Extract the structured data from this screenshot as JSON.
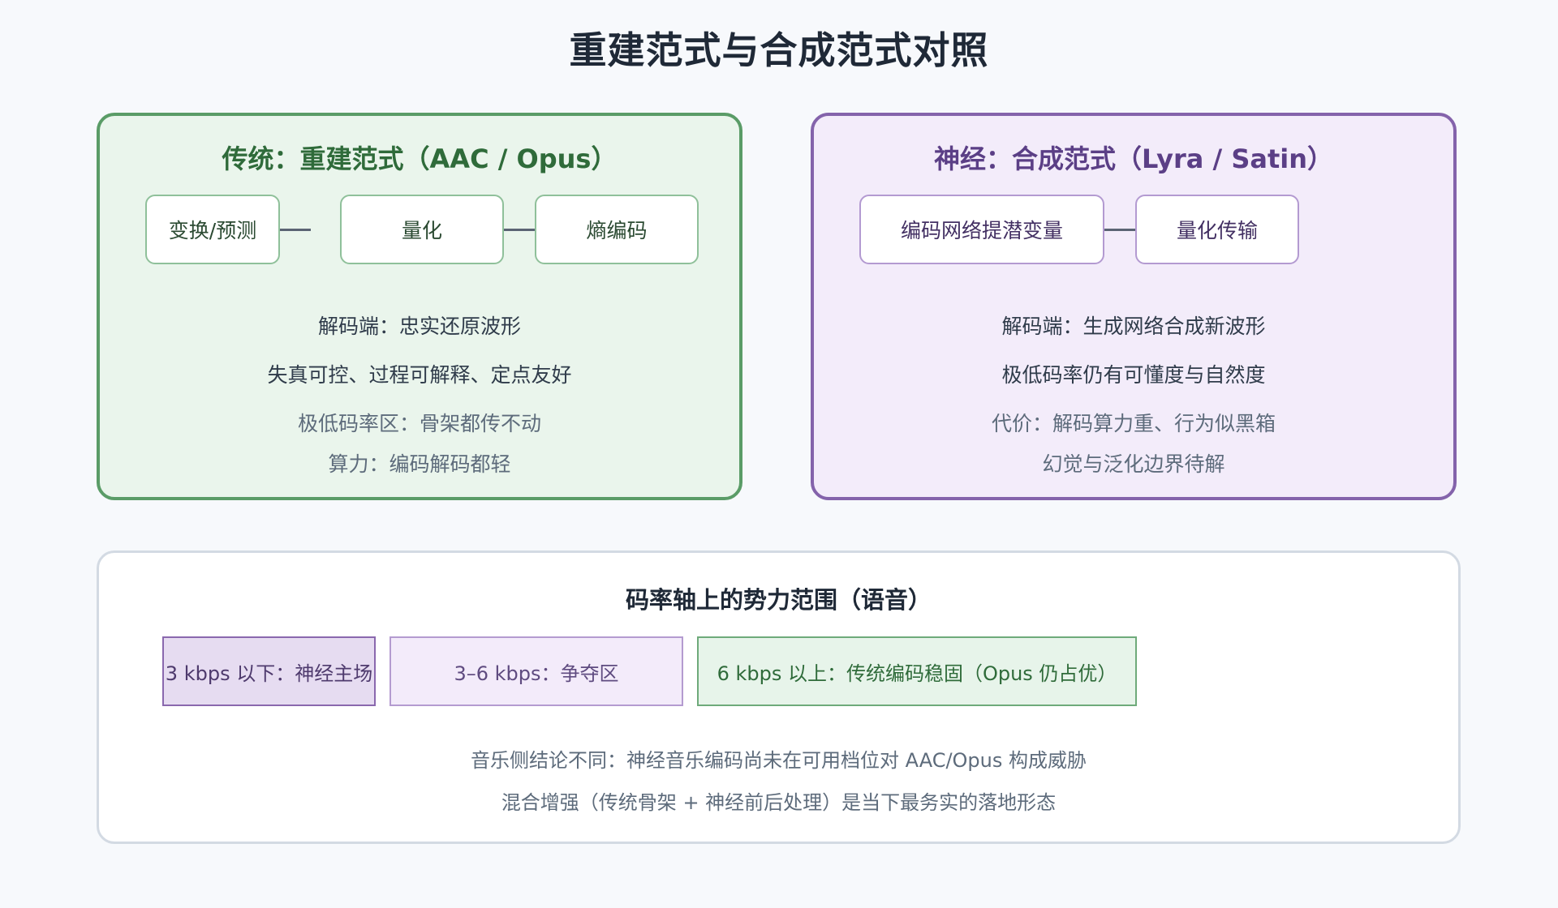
{
  "title": "重建范式与合成范式对照",
  "traditional": {
    "title": "传统：重建范式（AAC / Opus）",
    "steps": [
      "变换/预测",
      "量化",
      "熵编码"
    ],
    "notes": [
      "解码端：忠实还原波形",
      "失真可控、过程可解释、定点友好",
      "极低码率区：骨架都传不动",
      "算力：编码解码都轻"
    ]
  },
  "neural": {
    "title": "神经：合成范式（Lyra / Satin）",
    "steps": [
      "编码网络提潜变量",
      "量化传输"
    ],
    "notes": [
      "解码端：生成网络合成新波形",
      "极低码率仍有可懂度与自然度",
      "代价：解码算力重、行为似黑箱",
      "幻觉与泛化边界待解"
    ]
  },
  "bitrate": {
    "title": "码率轴上的势力范围（语音）",
    "bands": [
      "3 kbps 以下：神经主场",
      "3–6 kbps：争夺区",
      "6 kbps 以上：传统编码稳固（Opus 仍占优）"
    ],
    "notes": [
      "音乐侧结论不同：神经音乐编码尚未在可用档位对 AAC/Opus 构成威胁",
      "混合增强（传统骨架 + 神经前后处理）是当下最务实的落地形态"
    ]
  },
  "colors": {
    "traditional_accent": "#5a9c67",
    "neural_accent": "#8463ab",
    "connector": "#5b6474"
  }
}
